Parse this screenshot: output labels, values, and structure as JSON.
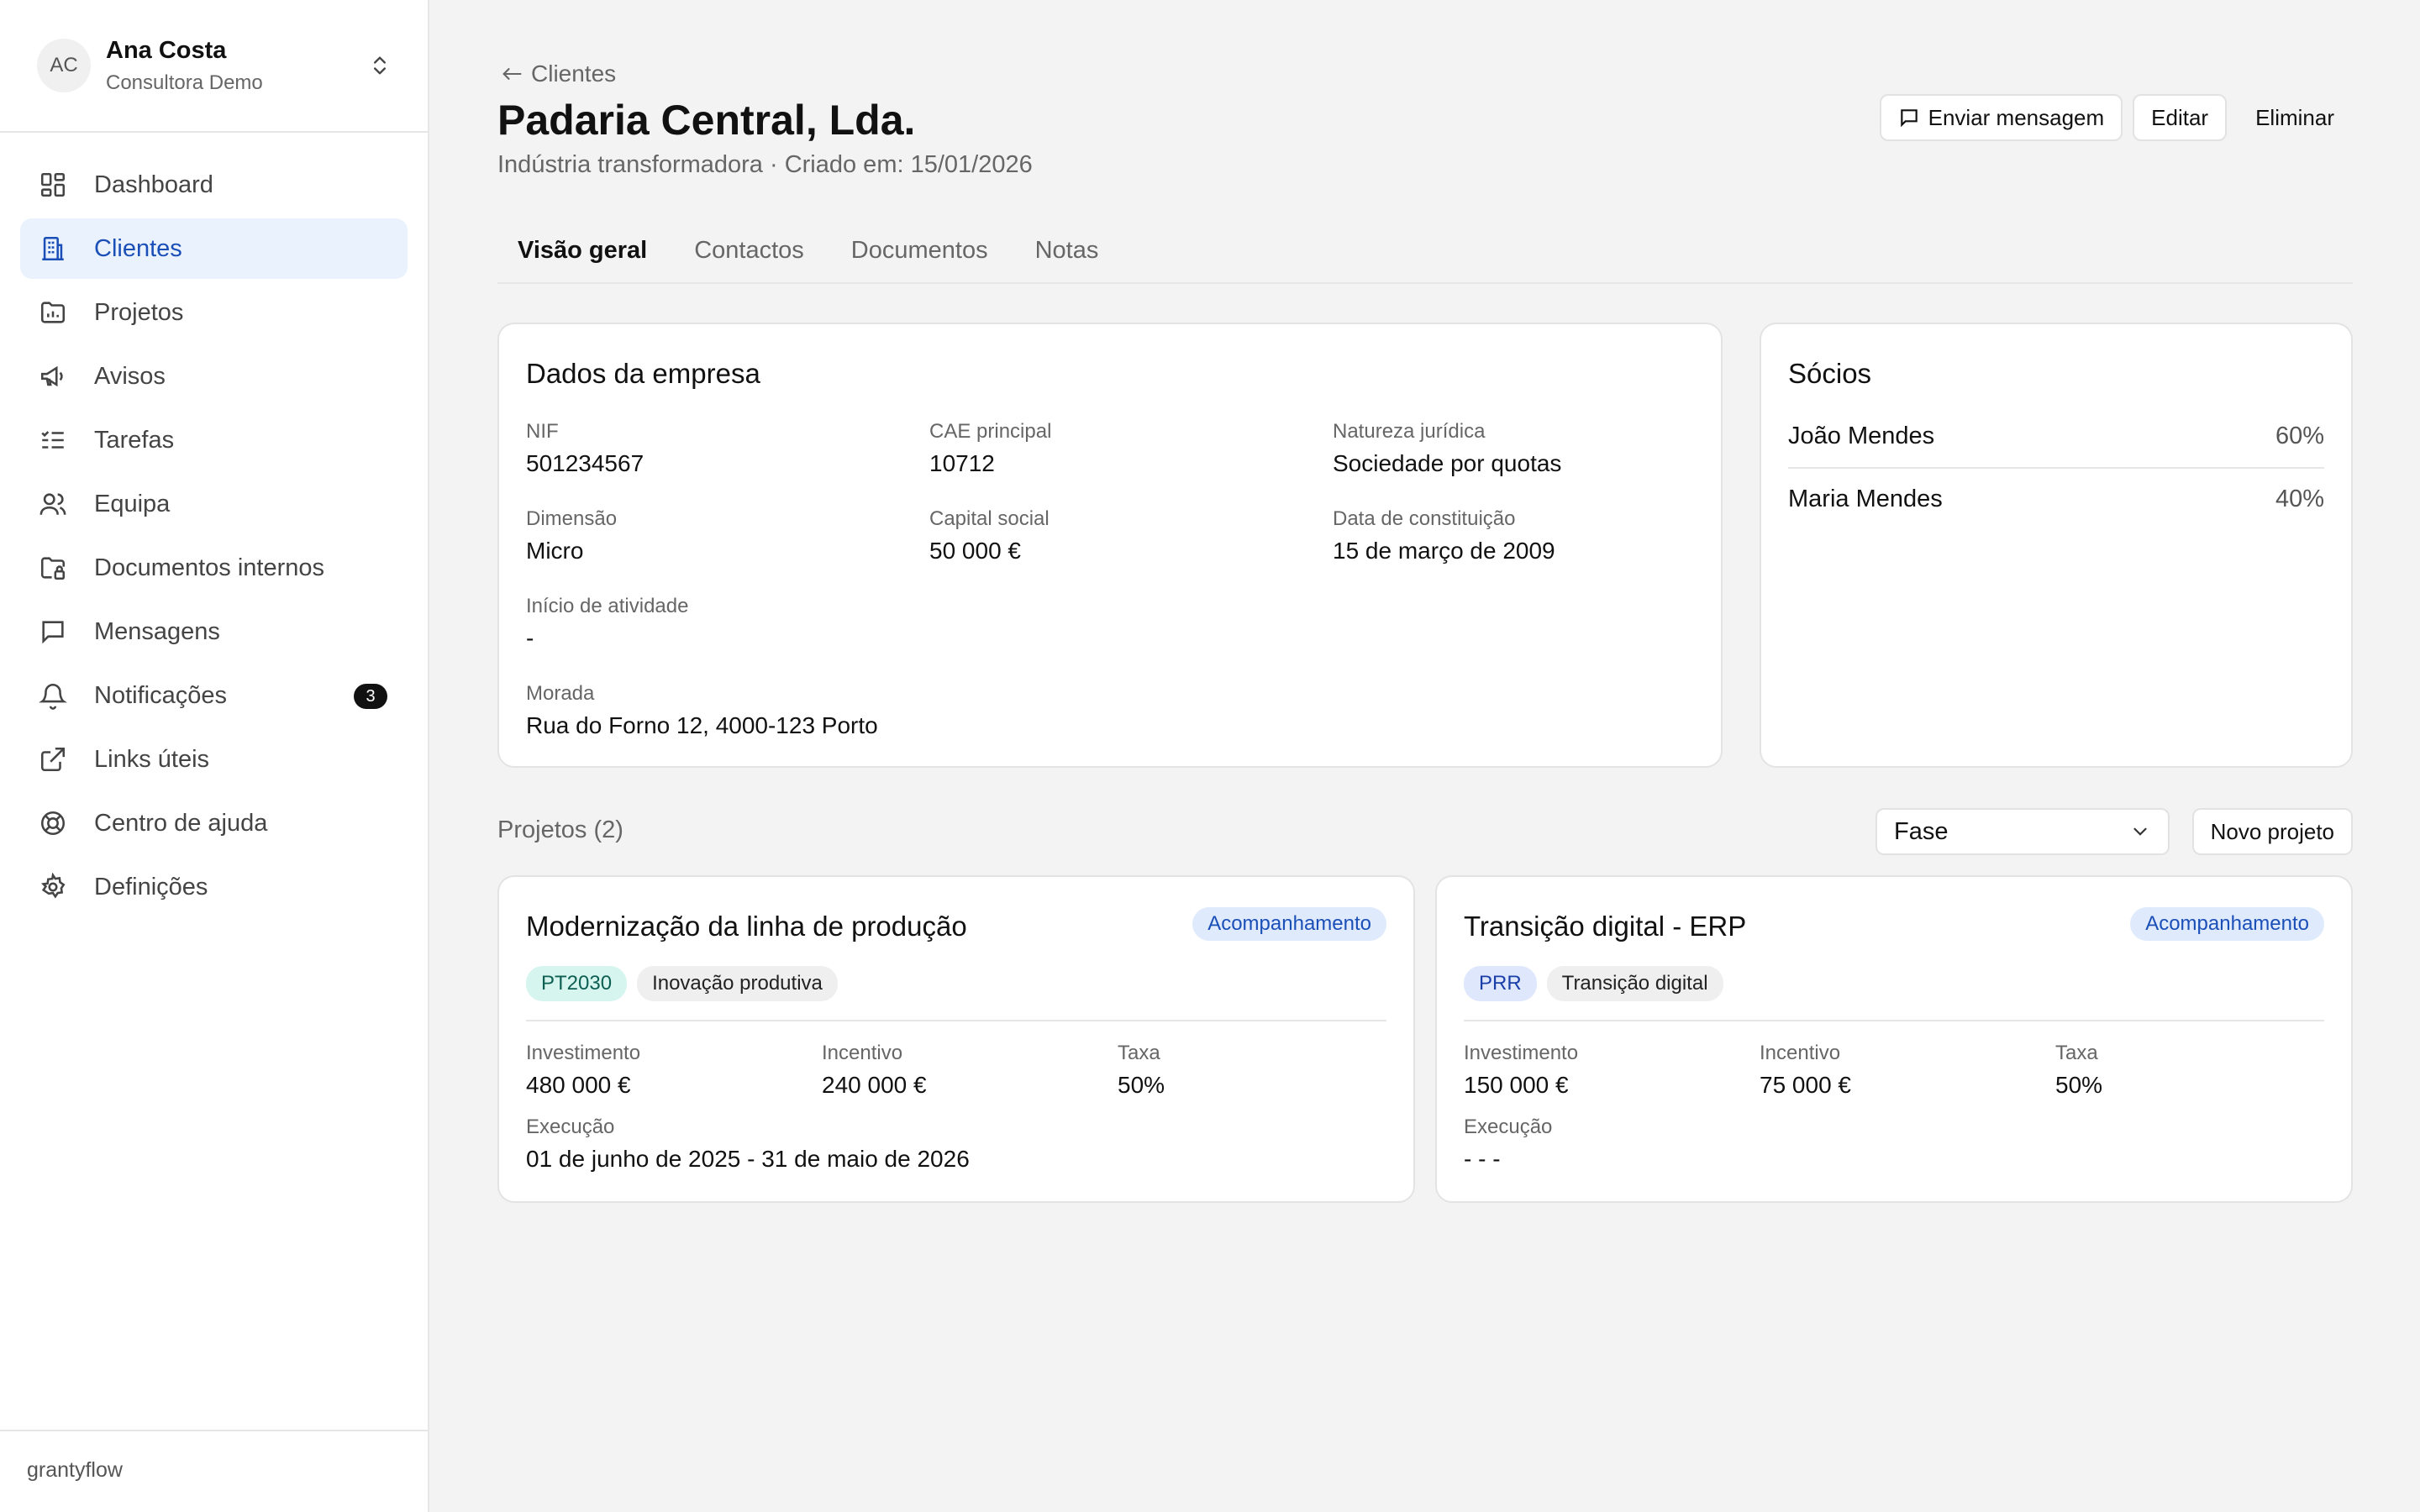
{
  "user": {
    "initials": "AC",
    "name": "Ana Costa",
    "role": "Consultora Demo"
  },
  "nav": [
    {
      "label": "Dashboard",
      "icon": "dashboard-icon"
    },
    {
      "label": "Clientes",
      "icon": "building-icon"
    },
    {
      "label": "Projetos",
      "icon": "folder-chart-icon"
    },
    {
      "label": "Avisos",
      "icon": "megaphone-icon"
    },
    {
      "label": "Tarefas",
      "icon": "list-check-icon"
    },
    {
      "label": "Equipa",
      "icon": "users-icon"
    },
    {
      "label": "Documentos internos",
      "icon": "folder-lock-icon"
    },
    {
      "label": "Mensagens",
      "icon": "message-icon"
    },
    {
      "label": "Notificações",
      "icon": "bell-icon",
      "badge": "3"
    },
    {
      "label": "Links úteis",
      "icon": "external-link-icon"
    },
    {
      "label": "Centro de ajuda",
      "icon": "life-buoy-icon"
    },
    {
      "label": "Definições",
      "icon": "gear-icon"
    }
  ],
  "active_nav": "Clientes",
  "brand": "grantyflow",
  "header": {
    "back_label": "Clientes",
    "title": "Padaria Central, Lda.",
    "subtitle": "Indústria transformadora · Criado em: 15/01/2026",
    "actions": {
      "message": "Enviar mensagem",
      "edit": "Editar",
      "delete": "Eliminar"
    }
  },
  "tabs": [
    "Visão geral",
    "Contactos",
    "Documentos",
    "Notas"
  ],
  "company": {
    "title": "Dados da empresa",
    "fields": {
      "nif": {
        "label": "NIF",
        "value": "501234567"
      },
      "cae": {
        "label": "CAE principal",
        "value": "10712"
      },
      "natureza": {
        "label": "Natureza jurídica",
        "value": "Sociedade por quotas"
      },
      "dimensao": {
        "label": "Dimensão",
        "value": "Micro"
      },
      "capital": {
        "label": "Capital social",
        "value": "50 000 €"
      },
      "constituicao": {
        "label": "Data de constituição",
        "value": "15 de março de 2009"
      },
      "inicio": {
        "label": "Início de atividade",
        "value": "-"
      },
      "morada": {
        "label": "Morada",
        "value": "Rua do Forno 12, 4000-123 Porto"
      }
    }
  },
  "partners": {
    "title": "Sócios",
    "rows": [
      {
        "name": "João Mendes",
        "pct": "60%"
      },
      {
        "name": "Maria Mendes",
        "pct": "40%"
      }
    ]
  },
  "projects": {
    "title": "Projetos (2)",
    "filter_value": "Fase",
    "new_label": "Novo projeto",
    "labels": {
      "investment": "Investimento",
      "incentive": "Incentivo",
      "rate": "Taxa",
      "execution": "Execução"
    },
    "items": [
      {
        "name": "Modernização da linha de produção",
        "status": "Acompanhamento",
        "tags": [
          "PT2030",
          "Inovação produtiva"
        ],
        "investment": "480 000 €",
        "incentive": "240 000 €",
        "rate": "50%",
        "execution": "01 de junho de 2025 - 31 de maio de 2026"
      },
      {
        "name": "Transição digital - ERP",
        "status": "Acompanhamento",
        "tags": [
          "PRR",
          "Transição digital"
        ],
        "investment": "150 000 €",
        "incentive": "75 000 €",
        "rate": "50%",
        "execution": "- - -"
      }
    ]
  },
  "colors": {
    "accent": "#1b4fb8",
    "active_bg": "#eaf2fd",
    "background": "#f3f3f3",
    "badge": "#111111"
  }
}
